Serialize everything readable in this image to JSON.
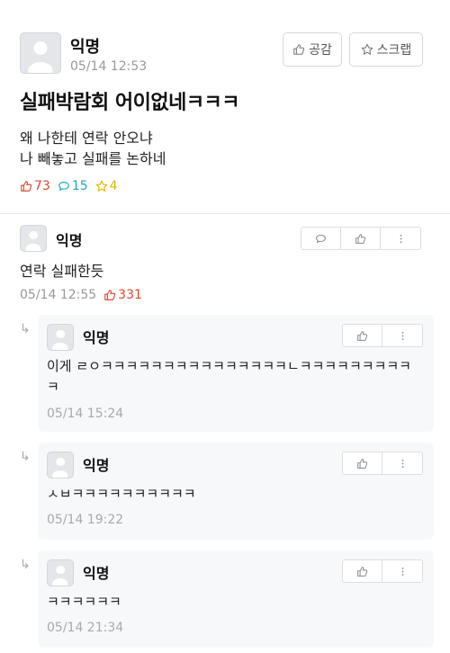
{
  "post": {
    "author": "익명",
    "time": "05/14 12:53",
    "like_button": "공감",
    "scrap_button": "스크랩",
    "title": "실패박람회 어이없네ㅋㅋㅋ",
    "body_lines": [
      "왜 나한테 연락 안오냐",
      "나 빼놓고 실패를 논하네"
    ],
    "stats": {
      "likes": "73",
      "comments": "15",
      "scraps": "4"
    }
  },
  "comment": {
    "author": "익명",
    "text": "연락 실패한듯",
    "time": "05/14 12:55",
    "likes": "331"
  },
  "replies": [
    {
      "author": "익명",
      "text": "이게 ㄹㅇㅋㅋㅋㅋㅋㅋㅋㅋㅋㅋㅋㅋㅋㅋㅋㄴㅋㅋㅋㅋㅋㅋㅋㅋㅋㅋ",
      "time": "05/14 15:24"
    },
    {
      "author": "익명",
      "text": "ㅅㅂㅋㅋㅋㅋㅋㅋㅋㅋㅋㅋ",
      "time": "05/14 19:22"
    },
    {
      "author": "익명",
      "text": "ㅋㅋㅋㅋㅋㅋ",
      "time": "05/14 21:34"
    }
  ],
  "colors": {
    "like": "#e0482f",
    "comment": "#1da6c8",
    "scrap": "#e0b600",
    "reply_bg": "#f7f8f9"
  },
  "icons": [
    "thumb-up-icon",
    "star-icon",
    "speech-bubble-icon",
    "more-vertical-icon",
    "reply-arrow-icon",
    "avatar-icon"
  ]
}
